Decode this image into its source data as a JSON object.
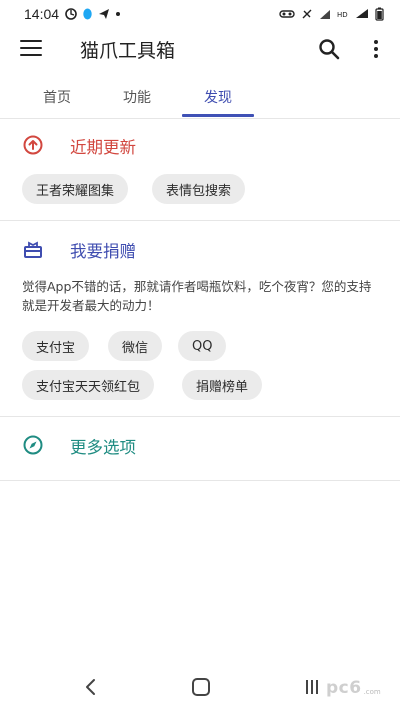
{
  "status_bar": {
    "time": "14:04",
    "icons_left": [
      "location-icon",
      "qq-icon",
      "telegram-icon",
      "dot-icon"
    ],
    "icons_right": [
      "mute-icon",
      "vibrate-icon",
      "signal-icon",
      "hd-icon",
      "wifi-icon",
      "battery-icon"
    ]
  },
  "app_bar": {
    "title": "猫爪工具箱"
  },
  "tabs": [
    {
      "label": "首页",
      "active": false
    },
    {
      "label": "功能",
      "active": false
    },
    {
      "label": "发现",
      "active": true
    }
  ],
  "sections": {
    "recent": {
      "title": "近期更新",
      "color": "#d2473f",
      "chips": [
        "王者荣耀图集",
        "表情包搜索"
      ]
    },
    "donate": {
      "title": "我要捐赠",
      "color": "#3f4db0",
      "text": "觉得App不错的话，那就请作者喝瓶饮料，吃个夜宵？您的支持就是开发者最大的动力！",
      "chips": [
        "支付宝",
        "微信",
        "QQ",
        "支付宝天天领红包",
        "捐赠榜单"
      ]
    },
    "more": {
      "title": "更多选项",
      "color": "#1f8c82"
    }
  },
  "watermark": {
    "text": "pc6",
    "sub": ".com"
  },
  "colors": {
    "accent": "#3f51b5",
    "chip_bg": "#ebebeb"
  }
}
